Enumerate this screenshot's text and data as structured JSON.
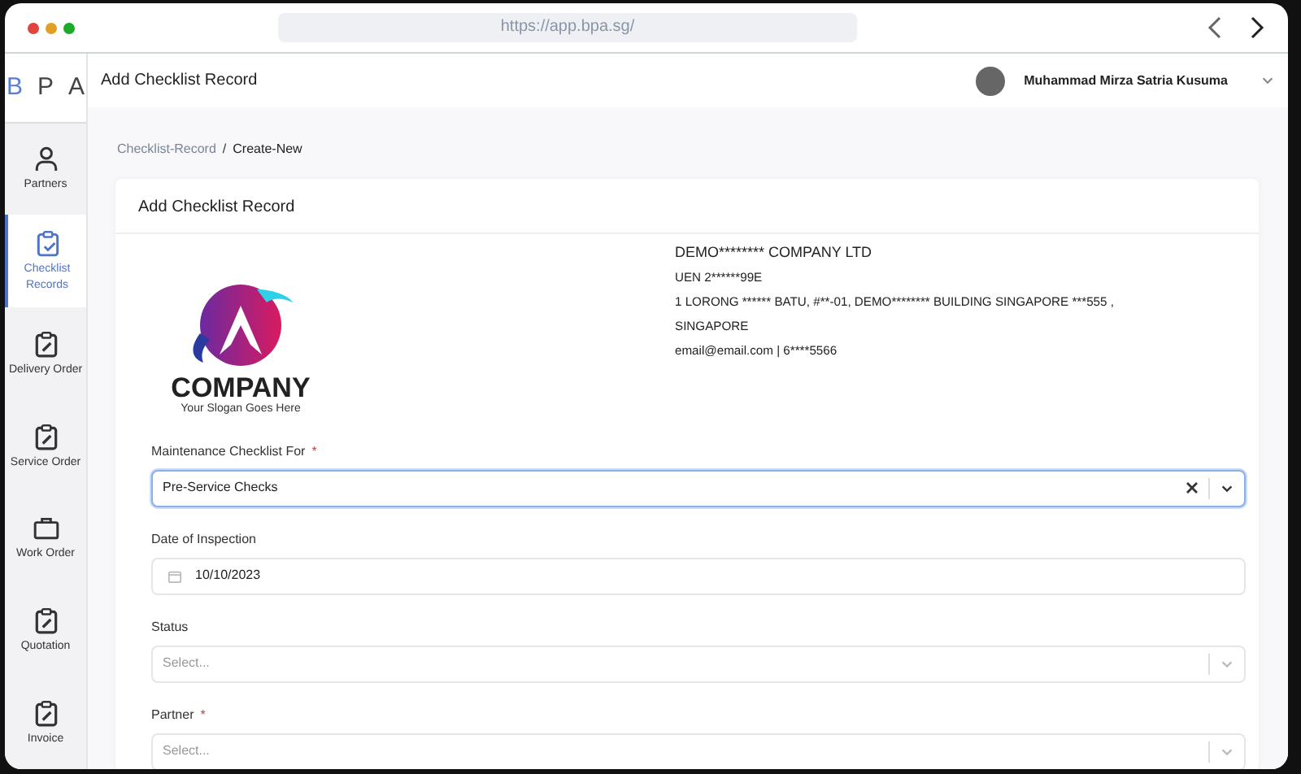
{
  "browser": {
    "url": "https://app.bpa.sg/"
  },
  "sidebar": {
    "logo": [
      "B",
      "P",
      "A"
    ],
    "items": [
      {
        "label": "Partners",
        "selected": false
      },
      {
        "label": "Checklist Records",
        "selected": true
      },
      {
        "label": "Delivery Order",
        "selected": false
      },
      {
        "label": "Service Order",
        "selected": false
      },
      {
        "label": "Work Order",
        "selected": false
      },
      {
        "label": "Quotation",
        "selected": false
      },
      {
        "label": "Invoice",
        "selected": false
      }
    ]
  },
  "header": {
    "title": "Add Checklist Record",
    "user": "Muhammad Mirza Satria Kusuma"
  },
  "breadcrumb_separator": "/",
  "breadcrumb": [
    {
      "label": "Checklist-Record",
      "selected": false
    },
    {
      "label": "Create-New",
      "selected": true
    }
  ],
  "card": {
    "title": "Add Checklist Record",
    "logo": {
      "name": "COMPANY",
      "slogan": "Your Slogan Goes Here"
    },
    "company": [
      "DEMO******** COMPANY LTD",
      "UEN 2******99E",
      "1 LORONG ****** BATU, #**-01, DEMO******** BUILDING SINGAPORE ***555 , SINGAPORE",
      "email@email.com | 6****5566"
    ],
    "fields": [
      {
        "kind": "select",
        "label": "Maintenance Checklist For",
        "required_mark": "*",
        "value": "Pre-Service Checks",
        "focused": true
      },
      {
        "kind": "date",
        "label": "Date of Inspection",
        "value": "10/10/2023",
        "focused": false
      },
      {
        "kind": "select",
        "label": "Status",
        "placeholder": "Select...",
        "focused": false
      },
      {
        "kind": "select",
        "label": "Partner",
        "required_mark": "*",
        "placeholder": "Select...",
        "focused": false
      }
    ]
  }
}
